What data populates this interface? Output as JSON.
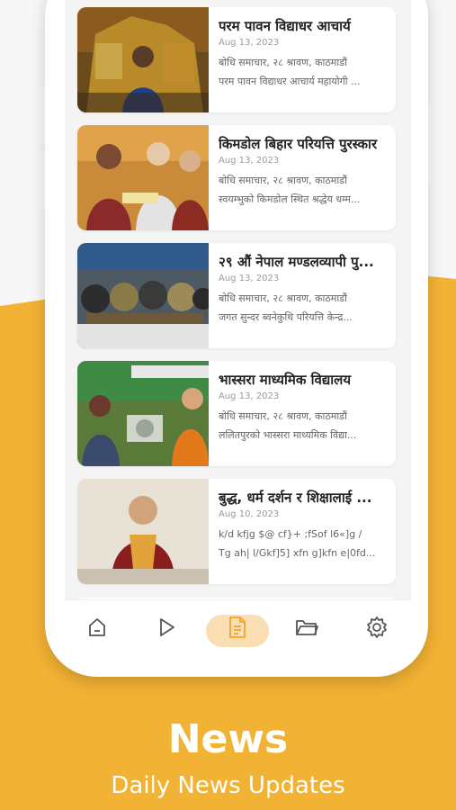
{
  "news": {
    "items": [
      {
        "title": "परम पावन विद्याधर आचार्य",
        "date": "Aug 13, 2023",
        "line1": "बोधि समाचार, २८ श्रावण, काठमाडौं",
        "line2": "परम पावन विद्याधर आचार्य महायोगी ..."
      },
      {
        "title": "किमडोल बिहार परियत्ति पुरस्कार",
        "date": "Aug 13, 2023",
        "line1": "बोधि समाचार, २८ श्रावण, काठमाडौं",
        "line2": "स्वयम्भुको किमडोल स्थित श्रद्धेय धम्म..."
      },
      {
        "title": "२९ औं नेपाल मण्डलव्यापी पु...",
        "date": "Aug 13, 2023",
        "line1": "बोधि समाचार, २८ श्रावण, काठमाडौं",
        "line2": "जगत सुन्दर ब्वनेकुथि परियत्ति केन्द्र..."
      },
      {
        "title": "भास्सरा माध्यमिक विद्यालय",
        "date": "Aug 13, 2023",
        "line1": "बोधि समाचार, २८ श्रावण, काठमाडौं",
        "line2": "ललितपुरको भास्सरा माध्यमिक विद्या..."
      },
      {
        "title": "बुद्ध, धर्म दर्शन र शिक्षालाई ...",
        "date": "Aug 10, 2023",
        "line1": "k/d kfjg $@ cf}+ ;fSof l6«]g /",
        "line2": "Tg ah| l/Gkf]5] xfn g]kfn e|0fd..."
      }
    ]
  },
  "nav": {
    "items": [
      {
        "icon": "home-icon",
        "active": false
      },
      {
        "icon": "play-icon",
        "active": false
      },
      {
        "icon": "document-icon",
        "active": true
      },
      {
        "icon": "folder-icon",
        "active": false
      },
      {
        "icon": "settings-icon",
        "active": false
      }
    ],
    "active_color": "#F2A52C",
    "inactive_color": "#555555"
  },
  "caption": {
    "title": "News",
    "subtitle": "Daily News Updates"
  },
  "colors": {
    "accent": "#F2B233",
    "card_bg": "#FFFFFF",
    "screen_bg": "#F4F4F4"
  }
}
